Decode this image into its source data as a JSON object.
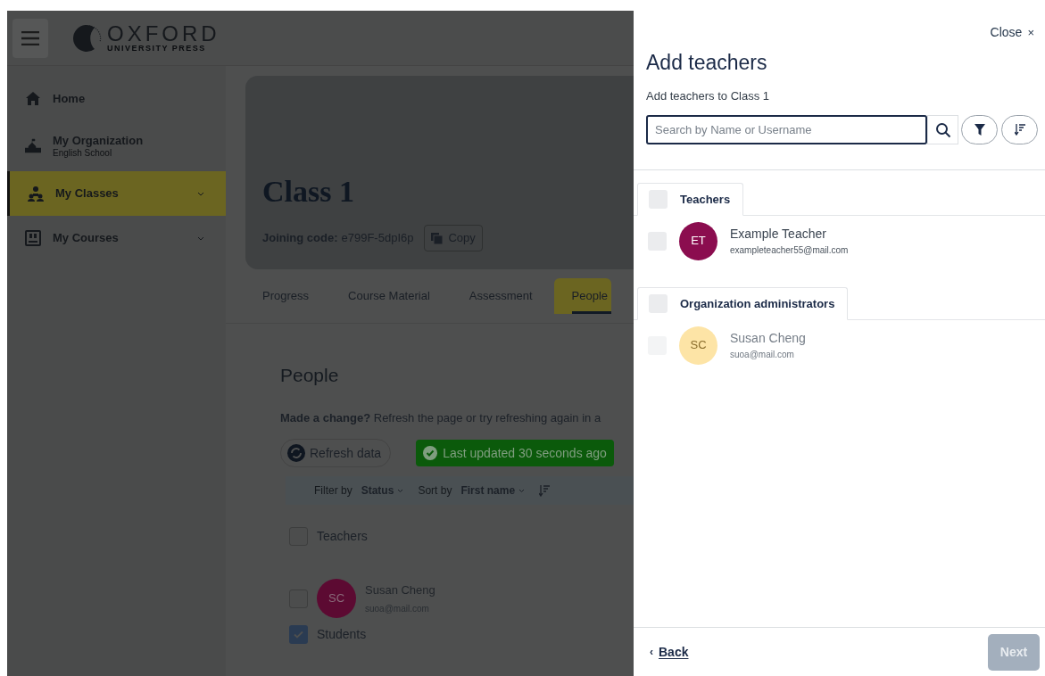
{
  "header": {
    "logo_title": "OXFORD",
    "logo_subtitle": "UNIVERSITY PRESS"
  },
  "sidebar": {
    "items": [
      {
        "label": "Home",
        "selected": false,
        "expandable": false
      },
      {
        "label": "My Organization",
        "sublabel": "English School",
        "selected": false,
        "expandable": false
      },
      {
        "label": "My Classes",
        "selected": true,
        "expandable": true
      },
      {
        "label": "My Courses",
        "selected": false,
        "expandable": true
      }
    ]
  },
  "class_card": {
    "title": "Class 1",
    "joining_code_label": "Joining code:",
    "joining_code": "e799F-5dpI6p",
    "copy_button": "Copy"
  },
  "tabs": [
    {
      "label": "Progress",
      "selected": false
    },
    {
      "label": "Course Material",
      "selected": false
    },
    {
      "label": "Assessment",
      "selected": false
    },
    {
      "label": "People",
      "selected": true
    }
  ],
  "people": {
    "heading": "People",
    "notice": "**Made a change?** Refresh the page or try refreshing again in a",
    "refresh_button": "Refresh data",
    "status_badge": "Last updated 30 seconds ago",
    "filter_label": "Filter by",
    "filter_value": "Status",
    "sort_label": "Sort by",
    "sort_value": "First name",
    "groups": [
      {
        "label": "Teachers",
        "checked": false,
        "members": [
          {
            "initials": "SC",
            "name": "Susan Cheng",
            "email": "suoa@mail.com",
            "checked": false
          }
        ]
      },
      {
        "label": "Students",
        "checked": true
      }
    ]
  },
  "panel": {
    "close": "Close",
    "close_icon": "×",
    "title": "Add teachers",
    "subtitle": "Add teachers to Class 1",
    "search_placeholder": "Search by Name or Username",
    "groups": [
      {
        "label": "Teachers",
        "checked": false,
        "members": [
          {
            "initials": "ET",
            "name": "Example Teacher",
            "email": "exampleteacher55@mail.com",
            "checked": false,
            "disabled": false,
            "color": "#8b0d4f"
          }
        ]
      },
      {
        "label": "Organization administrators",
        "checked": false,
        "members": [
          {
            "initials": "SC",
            "name": "Susan Cheng",
            "email": "suoa@mail.com",
            "checked": false,
            "disabled": true,
            "color": "#fde4a6"
          }
        ]
      }
    ],
    "back_icon": "‹",
    "back": "Back",
    "next": "Next",
    "next_disabled": true
  }
}
